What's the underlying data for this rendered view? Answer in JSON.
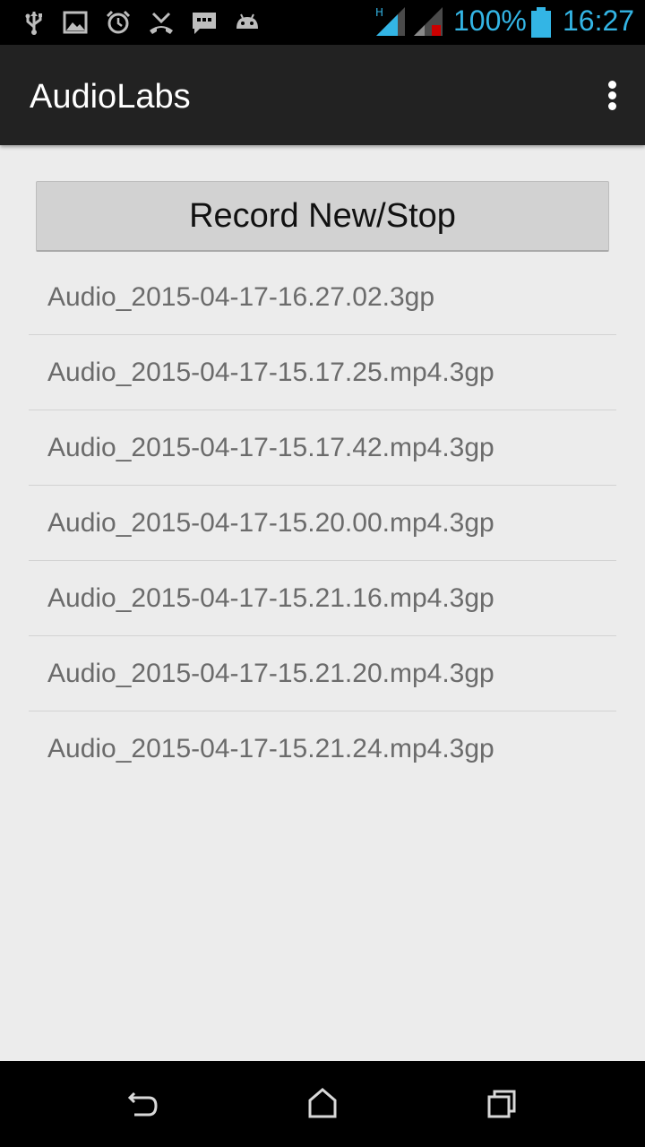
{
  "status_bar": {
    "icons": [
      "usb-icon",
      "image-icon",
      "alarm-icon",
      "missed-call-icon",
      "message-icon",
      "android-icon",
      "signal-h-icon",
      "signal-no-service-icon"
    ],
    "network_type": "H",
    "battery_percent": "100%",
    "time": "16:27",
    "accent_color": "#33b5e5"
  },
  "action_bar": {
    "title": "AudioLabs",
    "overflow_icon": "overflow-menu-icon"
  },
  "record_button": {
    "label": "Record New/Stop"
  },
  "recordings": [
    "Audio_2015-04-17-16.27.02.3gp",
    "Audio_2015-04-17-15.17.25.mp4.3gp",
    "Audio_2015-04-17-15.17.42.mp4.3gp",
    "Audio_2015-04-17-15.20.00.mp4.3gp",
    "Audio_2015-04-17-15.21.16.mp4.3gp",
    "Audio_2015-04-17-15.21.20.mp4.3gp",
    "Audio_2015-04-17-15.21.24.mp4.3gp"
  ],
  "nav_bar": {
    "buttons": [
      "back-icon",
      "home-icon",
      "recents-icon"
    ]
  }
}
